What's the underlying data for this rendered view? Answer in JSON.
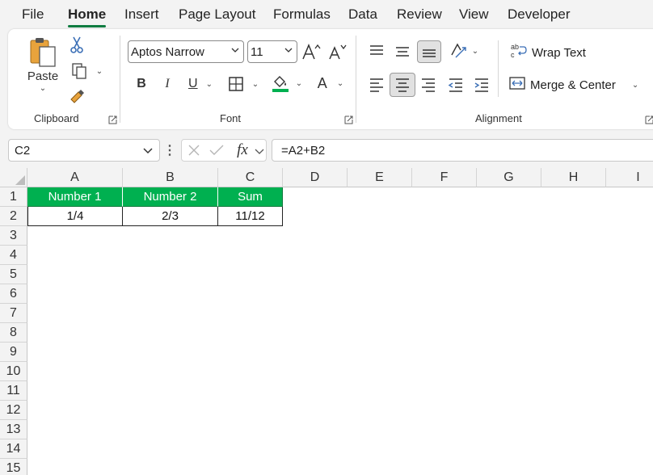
{
  "menu": {
    "tabs": [
      "File",
      "Home",
      "Insert",
      "Page Layout",
      "Formulas",
      "Data",
      "Review",
      "View",
      "Developer"
    ],
    "active_tab": "Home"
  },
  "ribbon": {
    "clipboard": {
      "paste_label": "Paste",
      "group_label": "Clipboard"
    },
    "font": {
      "font_name": "Aptos Narrow",
      "font_size": "11",
      "group_label": "Font",
      "fill_color": "#00b050"
    },
    "alignment": {
      "wrap_text_label": "Wrap Text",
      "merge_label": "Merge & Center",
      "group_label": "Alignment"
    }
  },
  "formula_bar": {
    "name_box": "C2",
    "formula": "=A2+B2"
  },
  "sheet": {
    "columns": [
      "A",
      "B",
      "C",
      "D",
      "E",
      "F",
      "G",
      "H",
      "I"
    ],
    "rows": [
      "1",
      "2",
      "3",
      "4",
      "5",
      "6",
      "7",
      "8",
      "9",
      "10",
      "11",
      "12",
      "13",
      "14",
      "15"
    ],
    "header_row": [
      "Number 1",
      "Number 2",
      "Sum"
    ],
    "data_row": [
      "1/4",
      "2/3",
      "11/12"
    ],
    "header_fill": "#00b050",
    "accent": "#107c41"
  }
}
